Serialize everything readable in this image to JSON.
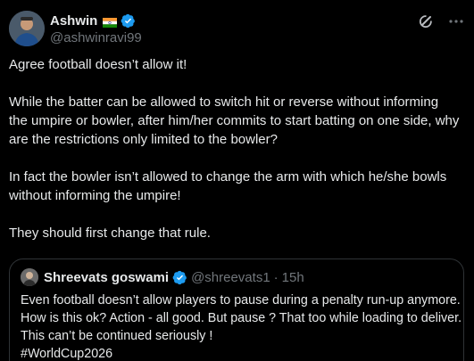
{
  "post": {
    "author": {
      "display_name": "Ashwin",
      "handle": "@ashwinravi99",
      "flag": "india-flag",
      "verified_icon": "verified-badge-icon"
    },
    "actions": {
      "grok_icon": "grok-icon",
      "more_icon": "more-options-icon"
    },
    "paragraphs": [
      "Agree football doesn’t allow it!",
      "While the batter can be allowed to switch hit or reverse without informing the umpire or bowler, after him/her commits to start batting on one side, why are the restrictions only limited to the bowler?",
      "In fact the bowler isn’t allowed to change the arm with which he/she bowls without informing the umpire!",
      "They should first change that rule."
    ]
  },
  "quote": {
    "display_name": "Shreevats goswami",
    "handle": "@shreevats1",
    "separator": "·",
    "time": "15h",
    "lines": [
      "Even football doesn’t allow players to pause during a penalty run-up anymore.",
      "How is this ok? Action - all good. But pause ? That too while loading to deliver.",
      "This can’t be continued seriously !",
      "#WorldCup2026"
    ]
  },
  "colors": {
    "background": "#000000",
    "text": "#e7e9ea",
    "muted": "#71767b",
    "border": "#2f3336",
    "verified": "#1d9bf0"
  }
}
